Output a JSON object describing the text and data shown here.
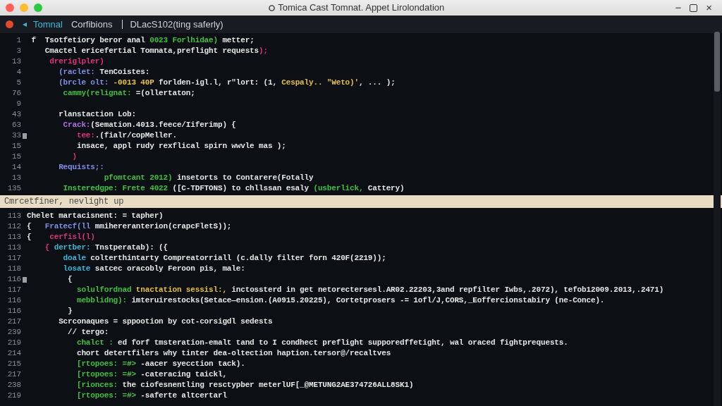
{
  "window": {
    "title": "Tomica Cast Tomnat. Appet Lirolondation",
    "controls": [
      "−",
      "×"
    ]
  },
  "tabs": [
    {
      "label": "Tomnal",
      "selected": true
    },
    {
      "label": "Corfibions",
      "selected": false
    }
  ],
  "breadcrumb": "DLacS102(ting saferly)",
  "editor": {
    "top_lines": [
      {
        "number": "1",
        "marked": false,
        "segments": [
          {
            "text": " f  Tsotfetiory beror anal ",
            "color": "#e6e6e6"
          },
          {
            "text": "0023 Forlhidae)",
            "color": "#3fc03f"
          },
          {
            "text": " metter;",
            "color": "#e6e6e6"
          }
        ]
      },
      {
        "number": "3",
        "marked": false,
        "segments": [
          {
            "text": "    Cmactel ericefertial Tomnata,preflight requests",
            "color": "#e6e6e6"
          },
          {
            "text": ");",
            "color": "#e0307a"
          }
        ]
      },
      {
        "number": "13",
        "marked": false,
        "segments": [
          {
            "text": "     dreriglpler)",
            "color": "#e0307a"
          }
        ]
      },
      {
        "number": "4",
        "marked": false,
        "segments": [
          {
            "text": "       (raclet: ",
            "color": "#7f8fe8"
          },
          {
            "text": "TenCoistes:",
            "color": "#e6e6e6"
          }
        ]
      },
      {
        "number": "5",
        "marked": false,
        "segments": [
          {
            "text": "       (brcle olt: ",
            "color": "#7f8fe8"
          },
          {
            "text": "-0013 40P",
            "color": "#e8c040"
          },
          {
            "text": " forlden-igl.l, r\"lort: (1, ",
            "color": "#e6e6e6"
          },
          {
            "text": "Cespaly.. \"Weto)'",
            "color": "#e8c040"
          },
          {
            "text": ", ... );",
            "color": "#e6e6e6"
          }
        ]
      },
      {
        "number": "76",
        "marked": false,
        "segments": [
          {
            "text": "        cammy(relignat: ",
            "color": "#3fc03f"
          },
          {
            "text": "=(ollertaton;",
            "color": "#e6e6e6"
          }
        ]
      },
      {
        "number": "9",
        "marked": false
      },
      {
        "number": "43",
        "marked": false,
        "segments": [
          {
            "text": "       rlanstaction Lob:",
            "color": "#e6e6e6"
          }
        ]
      },
      {
        "number": "63",
        "marked": false,
        "segments": [
          {
            "text": "        Crack:",
            "color": "#b070e0"
          },
          {
            "text": "(Semation.4013.feece/Iiferimp) {",
            "color": "#e6e6e6"
          }
        ]
      },
      {
        "number": "33",
        "marked": true,
        "segments": [
          {
            "text": "           tee:",
            "color": "#e0307a"
          },
          {
            "text": ".(fialr/copMeller.",
            "color": "#e6e6e6"
          }
        ]
      },
      {
        "number": "15",
        "marked": false,
        "segments": [
          {
            "text": "           insace, appl rudy rexflical spirn wwvle mas );",
            "color": "#e6e6e6"
          }
        ]
      },
      {
        "number": "15",
        "marked": false,
        "segments": [
          {
            "text": "          )",
            "color": "#e0307a"
          }
        ]
      },
      {
        "number": "14",
        "marked": false,
        "segments": [
          {
            "text": "       Requists;:",
            "color": "#7f8fe8"
          }
        ]
      },
      {
        "number": "13",
        "marked": false,
        "segments": [
          {
            "text": "                 pfomtcant 2012)",
            "color": "#3fc03f"
          },
          {
            "text": " insetorts to Contarere(Fotally",
            "color": "#e6e6e6"
          }
        ]
      },
      {
        "number": "135",
        "marked": false,
        "segments": [
          {
            "text": "        Insteredgpe: Frete 4022",
            "color": "#3fc03f"
          },
          {
            "text": " ([C-TDFTONS) to chllssan esaly ",
            "color": "#e6e6e6"
          },
          {
            "text": "(usberlick,",
            "color": "#3fc03f"
          },
          {
            "text": " Cattery)",
            "color": "#e6e6e6"
          }
        ]
      }
    ],
    "banner": "Cmrcetfiner, nevlight up",
    "bottom_lines": [
      {
        "number": "113",
        "marked": false,
        "segments": [
          {
            "text": "Chelet martacisnent: = tapher)",
            "color": "#e6e6e6"
          }
        ]
      },
      {
        "number": "112",
        "marked": false,
        "segments": [
          {
            "text": "{   ",
            "color": "#e6e6e6"
          },
          {
            "text": "Fratecf(ll",
            "color": "#7f8fe8"
          },
          {
            "text": " mmihereranterion(crapcFletS));",
            "color": "#e6e6e6"
          }
        ]
      },
      {
        "number": "113",
        "marked": false,
        "segments": [
          {
            "text": "{    ",
            "color": "#e6e6e6"
          },
          {
            "text": "cerfisl(l)",
            "color": "#e0307a"
          }
        ]
      },
      {
        "number": "113",
        "marked": false,
        "segments": [
          {
            "text": "    { ",
            "color": "#e0307a"
          },
          {
            "text": "dertber: ",
            "color": "#38b8d8"
          },
          {
            "text": "Tnstperatab): ({",
            "color": "#e6e6e6"
          }
        ]
      },
      {
        "number": "117",
        "marked": false,
        "segments": [
          {
            "text": "        doale",
            "color": "#38b8d8"
          },
          {
            "text": " colterthintarty Compreatorriall (c.dally filter forn 420F(2219));",
            "color": "#e6e6e6"
          }
        ]
      },
      {
        "number": "118",
        "marked": false,
        "segments": [
          {
            "text": "        losate",
            "color": "#38b8d8"
          },
          {
            "text": " satcec oracobly Feroon pis, male:",
            "color": "#e6e6e6"
          }
        ]
      },
      {
        "number": "116",
        "marked": true,
        "segments": [
          {
            "text": "         {",
            "color": "#e6e6e6"
          }
        ]
      },
      {
        "number": "117",
        "marked": false,
        "segments": [
          {
            "text": "           solulfordnad",
            "color": "#3fc03f"
          },
          {
            "text": " tnactation sessisl:,",
            "color": "#e8c040"
          },
          {
            "text": " inctossterd in get netorectersesl.AR02.22203,3and repfilter Iwbs,.2072), tefob12009.2013,.2471)",
            "color": "#e6e6e6"
          }
        ]
      },
      {
        "number": "116",
        "marked": false,
        "segments": [
          {
            "text": "           mebblidng):",
            "color": "#3fc03f"
          },
          {
            "text": " imteruirestocks(Setace—ension.(A0915.20225), Cortetprosers -= 1ofl/J,CORS,_Eoffercionstabiry (ne-Conce).",
            "color": "#e6e6e6"
          }
        ]
      },
      {
        "number": "116",
        "marked": false,
        "segments": [
          {
            "text": "         }",
            "color": "#e6e6e6"
          }
        ]
      },
      {
        "number": "217",
        "marked": false,
        "segments": [
          {
            "text": "       Scrconaques = sppootion by cot-corsigdl sedests",
            "color": "#e6e6e6"
          }
        ]
      },
      {
        "number": "239",
        "marked": false,
        "segments": [
          {
            "text": "         // tergo:",
            "color": "#e6e6e6"
          }
        ]
      },
      {
        "number": "219",
        "marked": false,
        "segments": [
          {
            "text": "           chalct :",
            "color": "#3fc03f"
          },
          {
            "text": " ed forf tmsteration-emalt tand to I condhect preflight supporedffetight, wal oraced fightprequests.",
            "color": "#e6e6e6"
          }
        ]
      },
      {
        "number": "214",
        "marked": false,
        "segments": [
          {
            "text": "           chort detertfilers why tinter dea-oltection haption.tersor@/recaltves",
            "color": "#e6e6e6"
          }
        ]
      },
      {
        "number": "215",
        "marked": false,
        "segments": [
          {
            "text": "           [rtopoes: =#>",
            "color": "#3fc03f"
          },
          {
            "text": " -aacer syecction tack).",
            "color": "#e6e6e6"
          }
        ]
      },
      {
        "number": "217",
        "marked": false,
        "segments": [
          {
            "text": "           [rtopoes: =#>",
            "color": "#3fc03f"
          },
          {
            "text": " -cateracing taickl,",
            "color": "#e6e6e6"
          }
        ]
      },
      {
        "number": "238",
        "marked": false,
        "segments": [
          {
            "text": "           [rionces:",
            "color": "#3fc03f"
          },
          {
            "text": " the ciofesnentling resctypber meterlUF[_@METUNG2AE374726ALL8SK1)",
            "color": "#e6e6e6"
          }
        ]
      },
      {
        "number": "219",
        "marked": false,
        "segments": [
          {
            "text": "           [rtopoes: =#>",
            "color": "#3fc03f"
          },
          {
            "text": " -saferte altcertarl",
            "color": "#e6e6e6"
          }
        ]
      }
    ]
  }
}
